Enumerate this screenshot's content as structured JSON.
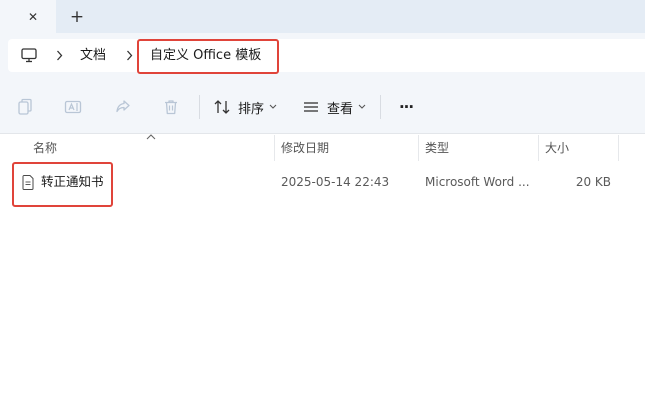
{
  "tabs": {
    "close_glyph": "✕",
    "new_tab_glyph": "+"
  },
  "address": {
    "crumbs": [
      "文档",
      "自定义 Office 模板"
    ]
  },
  "toolbar": {
    "sort_label": "排序",
    "view_label": "查看",
    "more_glyph": "···"
  },
  "columns": {
    "name": "名称",
    "modified": "修改日期",
    "type": "类型",
    "size": "大小"
  },
  "files": [
    {
      "name": "转正通知书",
      "modified": "2025-05-14 22:43",
      "type": "Microsoft Word ...",
      "size": "20 KB",
      "icon": "document-icon"
    }
  ],
  "colors": {
    "chrome": "#f3f6fa",
    "tab_strip": "#e4ecf5",
    "highlight": "#e0443a",
    "disabled_icon": "#b9c6d6"
  }
}
